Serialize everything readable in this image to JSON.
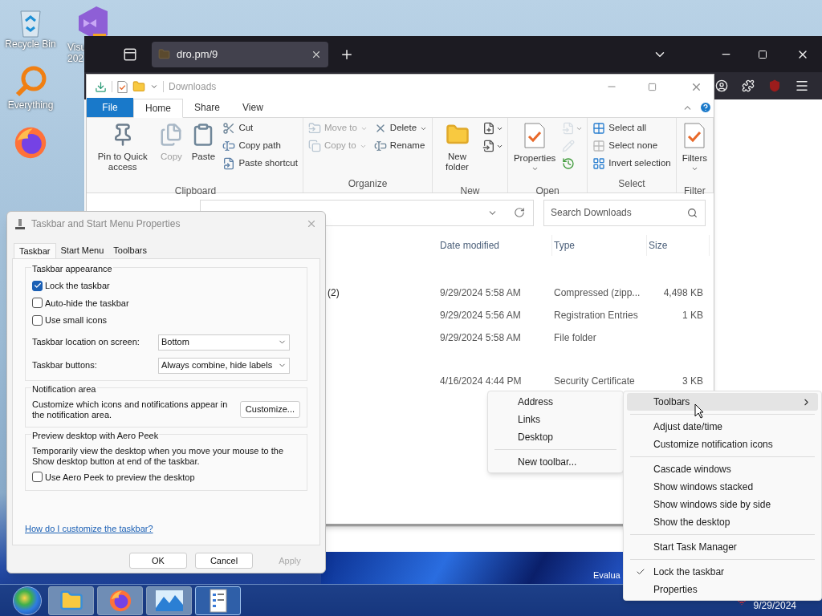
{
  "desktop": {
    "icons": [
      {
        "kind": "recycle",
        "label_lines": [
          "Recycle Bin"
        ]
      },
      {
        "kind": "studio",
        "label_lines": [
          "Visu",
          "202"
        ]
      },
      {
        "kind": "search",
        "label_lines": [
          "Everything"
        ]
      },
      {
        "kind": "firefox"
      }
    ],
    "edition_text": "Evalua"
  },
  "browser": {
    "tabs": [
      {
        "title": "dro.pm/9",
        "selected": true
      }
    ]
  },
  "explorer": {
    "title": "Downloads",
    "ribbon_tabs": [
      {
        "label": "File",
        "kind": "file",
        "selected": false
      },
      {
        "label": "Home",
        "kind": "tab",
        "selected": true
      },
      {
        "label": "Share",
        "kind": "tab",
        "selected": false
      },
      {
        "label": "View",
        "kind": "tab",
        "selected": false
      }
    ],
    "ribbon_groups": [
      {
        "label": "Clipboard",
        "columns": [
          [
            {
              "kind": "large",
              "label": "Pin to Quick access",
              "disabled": false,
              "dropdown": false
            }
          ],
          [
            {
              "kind": "large",
              "label": "Copy",
              "disabled": true,
              "dropdown": false
            }
          ],
          [
            {
              "kind": "large",
              "label": "Paste",
              "disabled": false,
              "dropdown": false
            }
          ],
          [
            {
              "kind": "small",
              "label": "Cut",
              "disabled": false,
              "dropdown": false
            },
            {
              "kind": "small",
              "label": "Copy path",
              "disabled": false,
              "dropdown": false
            },
            {
              "kind": "small",
              "label": "Paste shortcut",
              "disabled": false,
              "dropdown": false
            }
          ]
        ]
      },
      {
        "label": "Organize",
        "columns": [
          [
            {
              "kind": "small",
              "label": "Move to",
              "disabled": true,
              "dropdown": true
            },
            {
              "kind": "small",
              "label": "Copy to",
              "disabled": true,
              "dropdown": true
            }
          ],
          [
            {
              "kind": "small",
              "label": "Delete",
              "disabled": false,
              "dropdown": true
            },
            {
              "kind": "small",
              "label": "Rename",
              "disabled": false,
              "dropdown": false
            }
          ]
        ]
      },
      {
        "label": "New",
        "columns": [
          [
            {
              "kind": "large",
              "label": "New folder",
              "disabled": false,
              "dropdown": false
            }
          ],
          [
            {
              "kind": "icon",
              "disabled": false,
              "dropdown": true
            },
            {
              "kind": "icon",
              "disabled": false,
              "dropdown": true
            }
          ]
        ]
      },
      {
        "label": "Open",
        "columns": [
          [
            {
              "kind": "large",
              "label": "Properties",
              "disabled": false,
              "dropdown": true
            }
          ],
          [
            {
              "kind": "icon",
              "disabled": true,
              "dropdown": true
            },
            {
              "kind": "icon",
              "disabled": true,
              "dropdown": false
            },
            {
              "kind": "icon",
              "disabled": false,
              "dropdown": false
            }
          ]
        ]
      },
      {
        "label": "Select",
        "columns": [
          [
            {
              "kind": "small",
              "label": "Select all",
              "disabled": false,
              "dropdown": false
            },
            {
              "kind": "small",
              "label": "Select none",
              "disabled": false,
              "dropdown": false
            },
            {
              "kind": "small",
              "label": "Invert selection",
              "disabled": false,
              "dropdown": false
            }
          ]
        ]
      },
      {
        "label": "Filter",
        "columns": [
          [
            {
              "kind": "large",
              "label": "Filters",
              "disabled": false,
              "dropdown": true
            }
          ]
        ]
      }
    ],
    "search": {
      "placeholder": "Search Downloads"
    },
    "columns": [
      "Date modified",
      "Type",
      "Size"
    ],
    "groups": [
      {
        "rows": [
          {
            "name": "(2)",
            "date": "9/29/2024 5:58 AM",
            "type": "Compressed (zipp...",
            "size": "4,498 KB"
          },
          {
            "date": "9/29/2024 5:56 AM",
            "type": "Registration Entries",
            "size": "1 KB"
          },
          {
            "date": "9/29/2024 5:58 AM",
            "type": "File folder"
          }
        ]
      },
      {
        "rows": [
          {
            "date": "4/16/2024 4:44 PM",
            "type": "Security Certificate",
            "size": "3 KB"
          }
        ]
      }
    ]
  },
  "dialog": {
    "title": "Taskbar and Start Menu Properties",
    "tabs": [
      {
        "label": "Taskbar",
        "selected": true
      },
      {
        "label": "Start Menu",
        "selected": false
      },
      {
        "label": "Toolbars",
        "selected": false
      }
    ],
    "sections": [
      {
        "title": "Taskbar appearance",
        "checkboxes": [
          {
            "label": "Lock the taskbar",
            "checked": true
          },
          {
            "label": "Auto-hide the taskbar",
            "checked": false
          },
          {
            "label": "Use small icons",
            "checked": false
          }
        ],
        "selects": [
          {
            "label": "Taskbar location on screen:",
            "value": "Bottom"
          },
          {
            "label": "Taskbar buttons:",
            "value": "Always combine, hide labels"
          }
        ]
      },
      {
        "title": "Notification area",
        "text": "Customize which icons and notifications appear in the notification area.",
        "button": "Customize..."
      },
      {
        "title": "Preview desktop with Aero Peek",
        "text": "Temporarily view the desktop when you move your mouse to the Show desktop button at end of the taskbar.",
        "checkboxes": [
          {
            "label": "Use Aero Peek to preview the desktop",
            "checked": false
          }
        ]
      }
    ],
    "link": "How do I customize the taskbar?",
    "buttons": [
      {
        "label": "OK",
        "disabled": false
      },
      {
        "label": "Cancel",
        "disabled": false
      },
      {
        "label": "Apply",
        "disabled": true
      }
    ]
  },
  "toolbars_submenu": [
    {
      "kind": "item",
      "label": "Address"
    },
    {
      "kind": "item",
      "label": "Links"
    },
    {
      "kind": "item",
      "label": "Desktop"
    },
    {
      "kind": "separator"
    },
    {
      "kind": "item",
      "label": "New toolbar..."
    }
  ],
  "context_menu": [
    {
      "kind": "submenu",
      "label": "Toolbars",
      "checked": false,
      "highlighted": true
    },
    {
      "kind": "separator"
    },
    {
      "kind": "item",
      "label": "Adjust date/time",
      "checked": false,
      "highlighted": false
    },
    {
      "kind": "item",
      "label": "Customize notification icons",
      "checked": false,
      "highlighted": false
    },
    {
      "kind": "separator"
    },
    {
      "kind": "item",
      "label": "Cascade windows",
      "checked": false,
      "highlighted": false
    },
    {
      "kind": "item",
      "label": "Show windows stacked",
      "checked": false,
      "highlighted": false
    },
    {
      "kind": "item",
      "label": "Show windows side by side",
      "checked": false,
      "highlighted": false
    },
    {
      "kind": "item",
      "label": "Show the desktop",
      "checked": false,
      "highlighted": false
    },
    {
      "kind": "separator"
    },
    {
      "kind": "item",
      "label": "Start Task Manager",
      "checked": false,
      "highlighted": false
    },
    {
      "kind": "separator"
    },
    {
      "kind": "item",
      "label": "Lock the taskbar",
      "checked": true,
      "highlighted": false
    },
    {
      "kind": "item",
      "label": "Properties",
      "checked": false,
      "highlighted": false
    }
  ],
  "taskbar": {
    "apps": [
      {
        "kind": "explorer",
        "selected": false
      },
      {
        "kind": "firefox",
        "selected": false
      },
      {
        "kind": "photos",
        "selected": false
      },
      {
        "kind": "settings",
        "selected": true
      }
    ],
    "clock": "9/29/2024"
  }
}
